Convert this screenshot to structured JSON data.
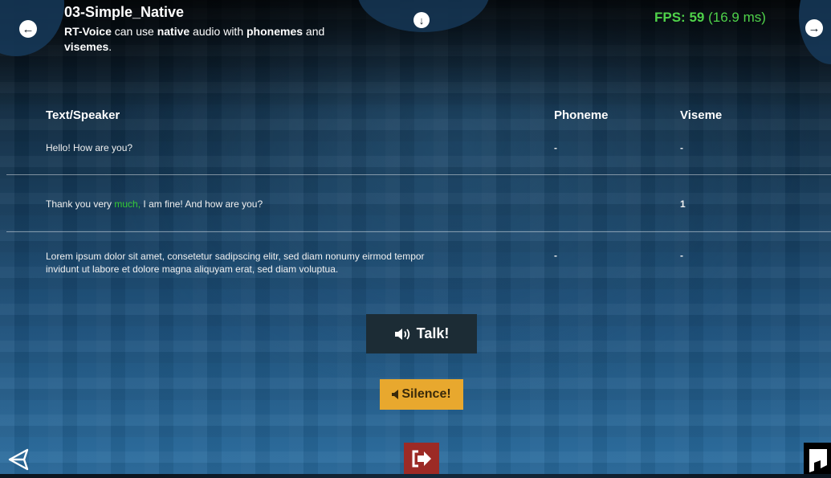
{
  "header": {
    "title": "03-Simple_Native",
    "subtitle_parts": [
      "RT-Voice",
      " can use ",
      "native",
      " audio with ",
      "phonemes",
      " and ",
      "visemes",
      "."
    ],
    "fps_label": "FPS: 59",
    "fps_ms": "(16.9 ms)"
  },
  "table": {
    "headers": [
      "Text/Speaker",
      "Phoneme",
      "Viseme"
    ],
    "rows": [
      {
        "text": "Hello! How are you?",
        "phoneme": "-",
        "viseme": "-"
      },
      {
        "text_before": "Thank you very ",
        "text_highlight": "much,",
        "text_after": " I am fine! And how are you?",
        "phoneme": "",
        "viseme": "1"
      },
      {
        "text_line1": "Lorem ipsum dolor sit amet, consetetur sadipscing elitr, sed diam nonumy eirmod tempor",
        "text_line2": "invidunt ut labore et dolore magna aliquyam erat, sed diam voluptua.",
        "phoneme": "-",
        "viseme": "-"
      }
    ]
  },
  "buttons": {
    "talk_label": "Talk!",
    "silence_label": "Silence!"
  },
  "icons": {
    "prev": "arrow-left-circle-icon",
    "next": "arrow-right-circle-icon",
    "down": "arrow-down-circle-icon",
    "talk": "speaker-loud-icon",
    "silence": "speaker-quiet-icon",
    "exit": "exit-icon",
    "unity": "unity-logo-icon",
    "asset": "asset-store-logo-icon"
  },
  "colors": {
    "fps": "#4fd24a",
    "highlight": "#35c935",
    "talk_bg": "#1c2c35",
    "silence_bg": "#e8a82e",
    "exit_bg": "#9c2a25"
  }
}
